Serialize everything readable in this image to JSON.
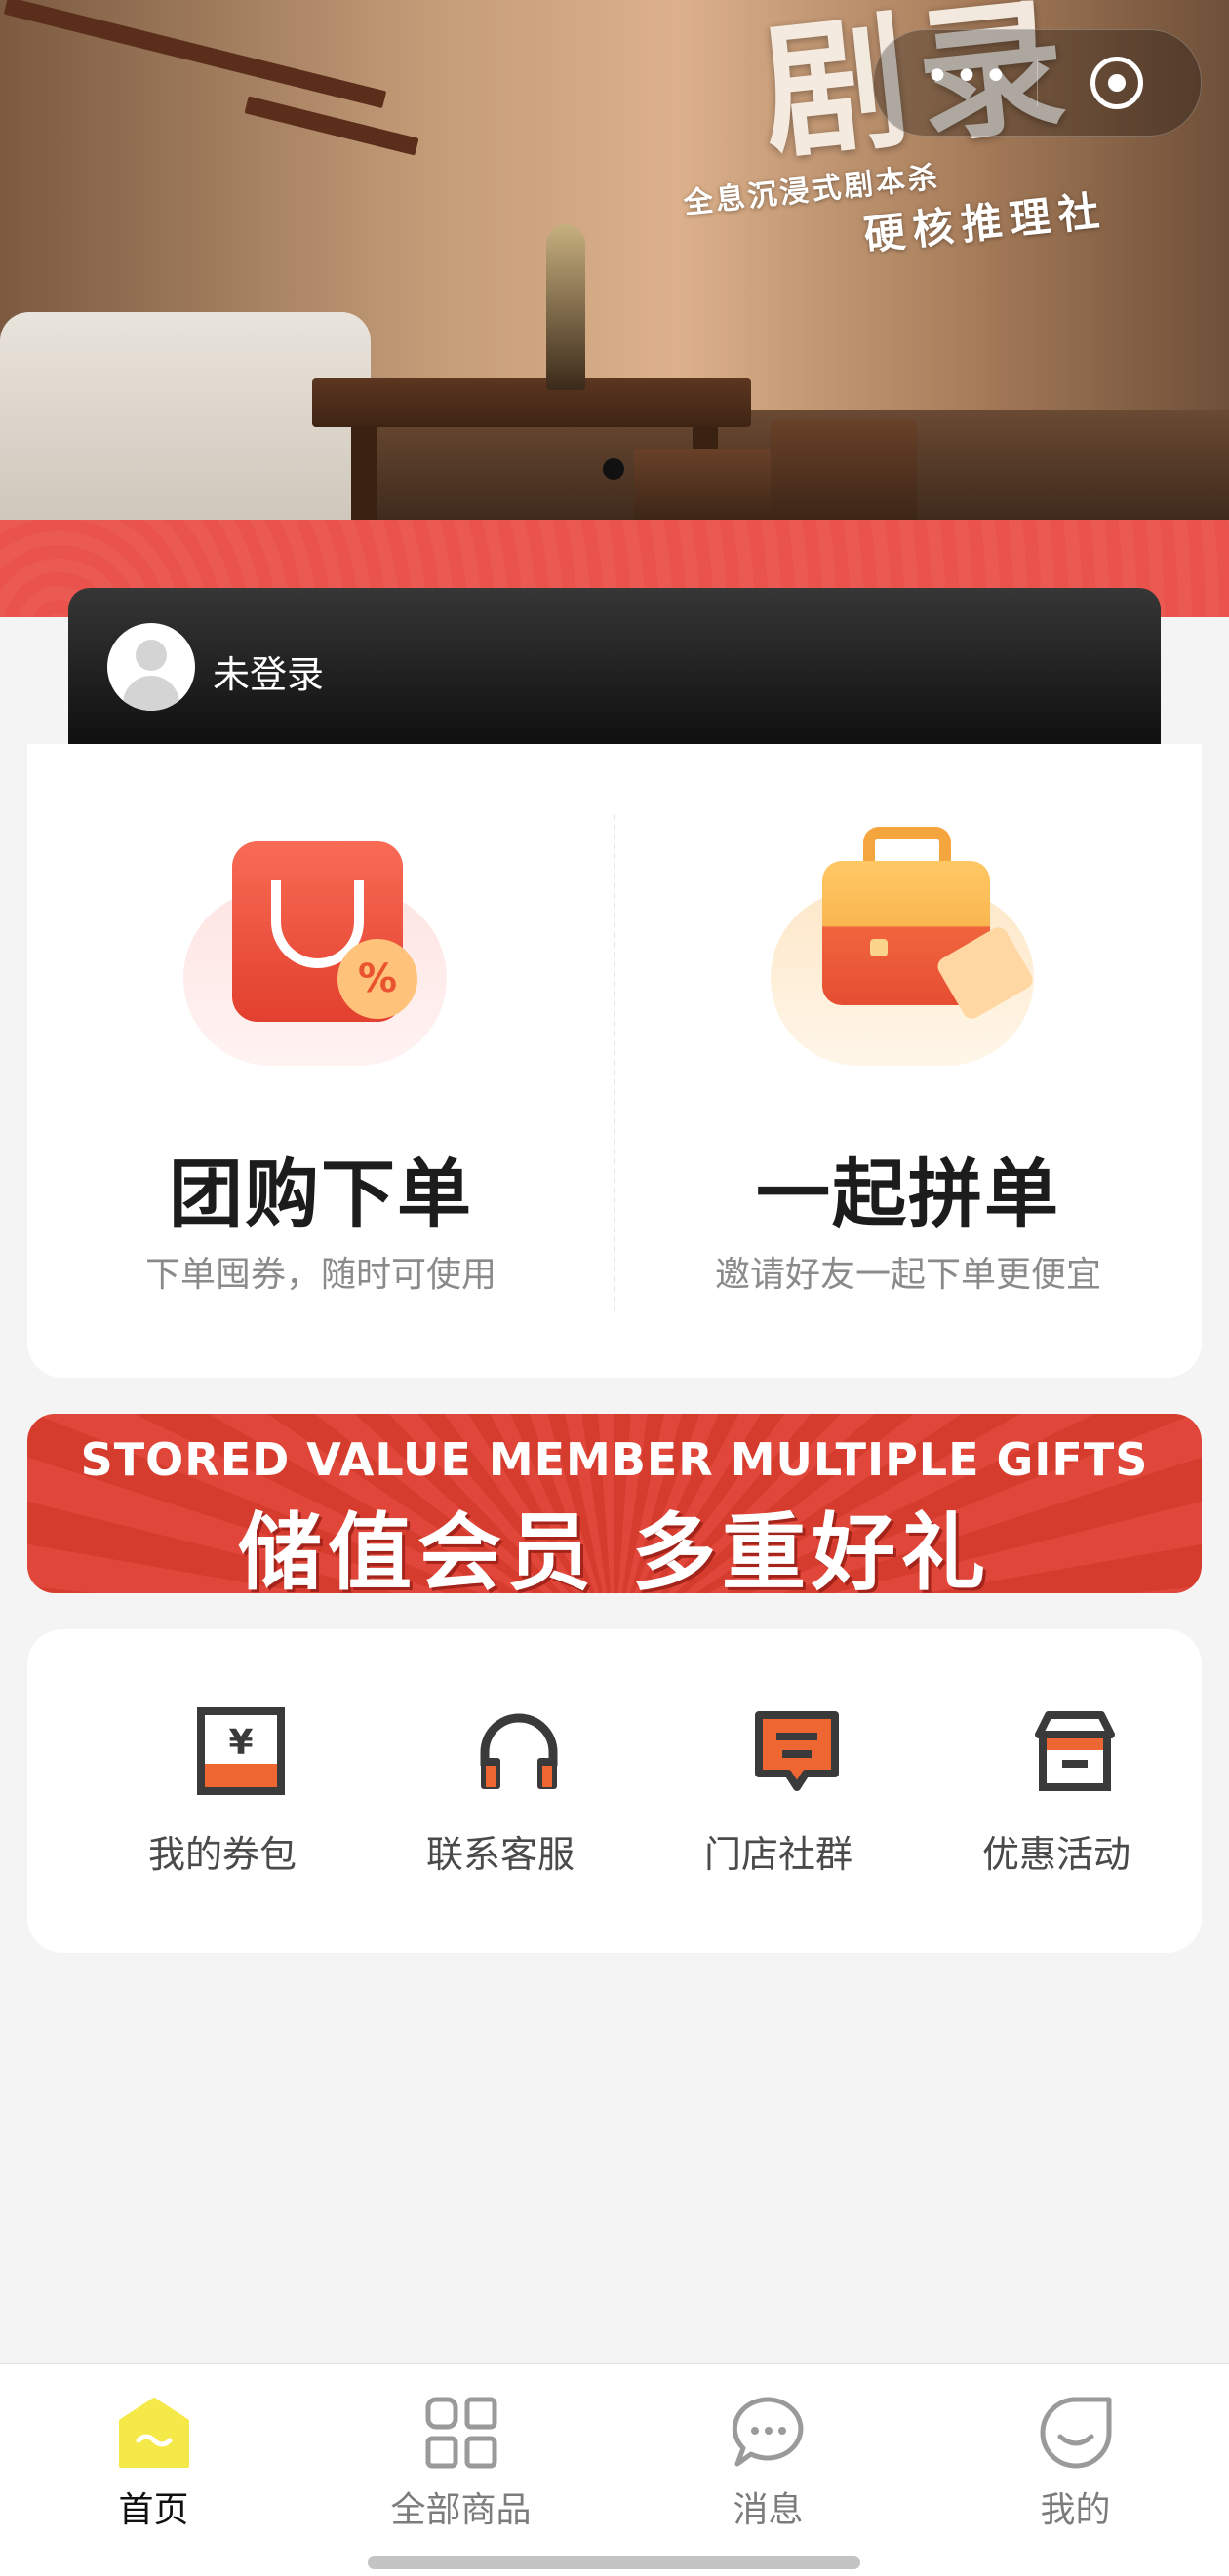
{
  "banner": {
    "wall_title": "剧录",
    "wall_subtitle_1": "全息沉浸式剧本杀",
    "wall_subtitle_2": "硬核推理社",
    "capsule": {
      "more_icon": "more-dots-icon",
      "close_icon": "target-icon"
    },
    "slide_count": 1
  },
  "user": {
    "status": "未登录",
    "avatar_icon": "user-avatar-icon"
  },
  "features": [
    {
      "title": "团购下单",
      "subtitle": "下单囤券，随时可使用",
      "icon": "shopping-bag-icon"
    },
    {
      "title": "一起拼单",
      "subtitle": "邀请好友一起下单更便宜",
      "icon": "briefcase-icon"
    }
  ],
  "promo": {
    "english": "STORED VALUE MEMBER MULTIPLE GIFTS",
    "chinese": "储值会员 多重好礼"
  },
  "quick_menu": [
    {
      "label": "我的券包",
      "icon": "coupon-wallet-icon"
    },
    {
      "label": "联系客服",
      "icon": "headphones-icon"
    },
    {
      "label": "门店社群",
      "icon": "chat-bubble-icon"
    },
    {
      "label": "优惠活动",
      "icon": "store-icon"
    }
  ],
  "tabbar": [
    {
      "label": "首页",
      "icon": "home-icon",
      "active": true
    },
    {
      "label": "全部商品",
      "icon": "grid-icon",
      "active": false
    },
    {
      "label": "消息",
      "icon": "message-icon",
      "active": false
    },
    {
      "label": "我的",
      "icon": "profile-smile-icon",
      "active": false
    }
  ],
  "colors": {
    "accent_red": "#e9534b",
    "active_tab": "#f5e94a",
    "dark_card": "#1a1a1a",
    "icon_orange": "#ee6631"
  }
}
